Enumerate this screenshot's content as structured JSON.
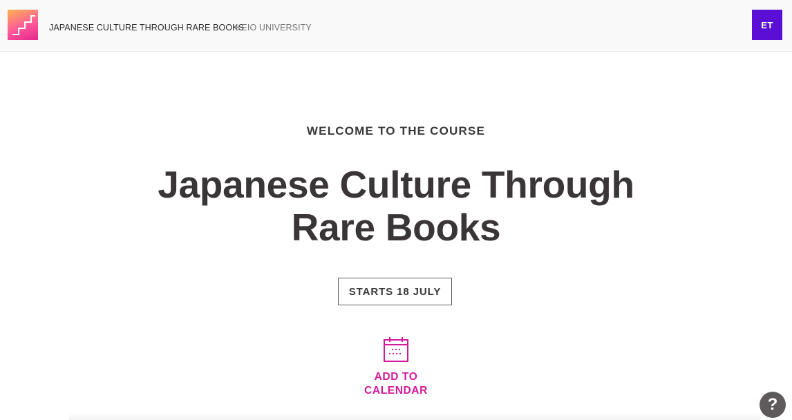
{
  "header": {
    "course_title": "JAPANESE CULTURE THROUGH RARE BOOKS",
    "organization": "KEIO UNIVERSITY",
    "logo_icon": "futurelearn-steps-logo",
    "avatar_initials": "ET",
    "avatar_color": "#5b0ed6"
  },
  "hero": {
    "welcome": "WELCOME TO THE COURSE",
    "title": "Japanese Culture Through Rare Books",
    "start_date": "STARTS 18 JULY",
    "calendar": {
      "icon": "calendar-icon",
      "label": "ADD TO CALENDAR",
      "accent": "#d6189a"
    }
  },
  "help": {
    "icon": "help-question-icon",
    "glyph": "?"
  }
}
